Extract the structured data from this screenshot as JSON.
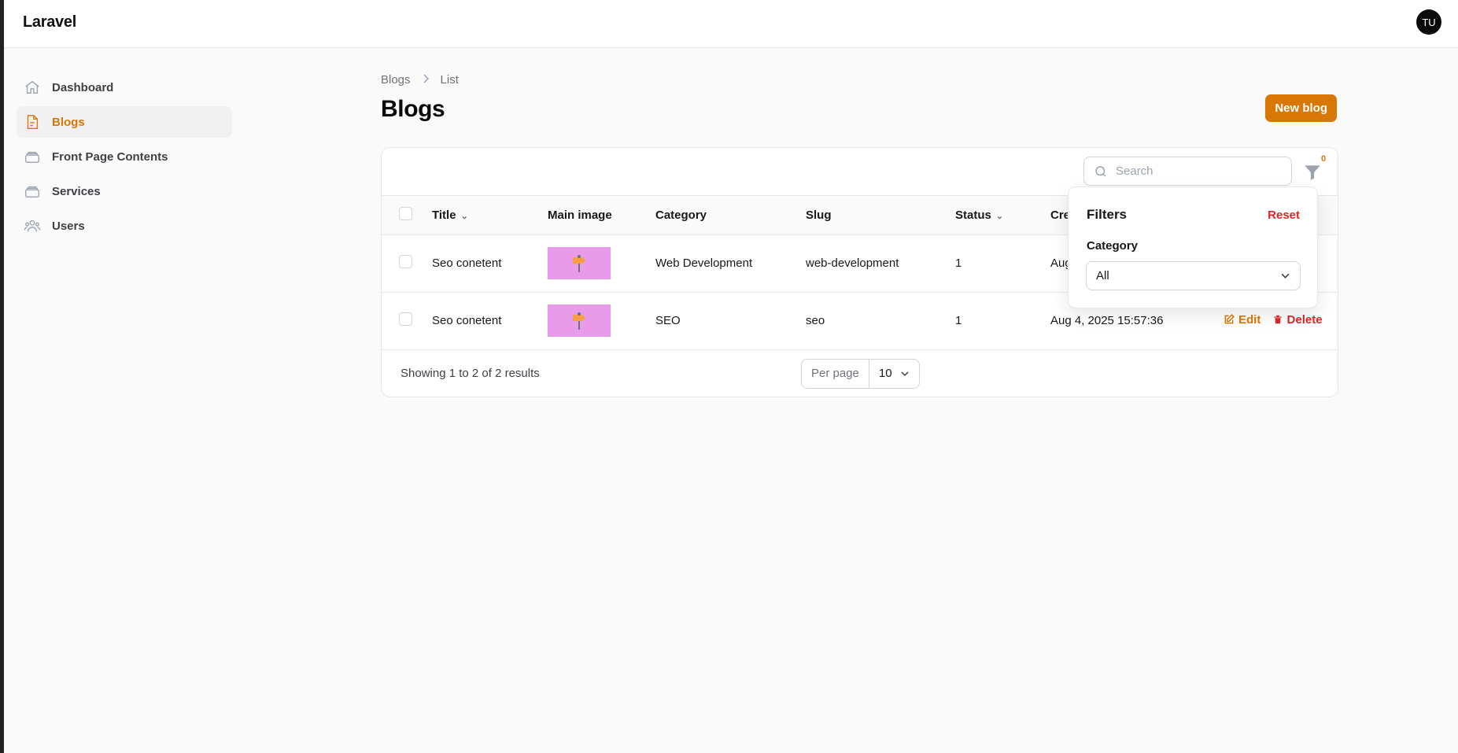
{
  "app": {
    "brand": "Laravel",
    "avatar_initials": "TU"
  },
  "sidebar": {
    "items": [
      {
        "label": "Dashboard",
        "icon": "home-icon",
        "active": false
      },
      {
        "label": "Blogs",
        "icon": "document-icon",
        "active": true
      },
      {
        "label": "Front Page Contents",
        "icon": "stack-icon",
        "active": false
      },
      {
        "label": "Services",
        "icon": "stack-icon",
        "active": false
      },
      {
        "label": "Users",
        "icon": "users-icon",
        "active": false
      }
    ]
  },
  "breadcrumb": [
    "Blogs",
    "List"
  ],
  "page": {
    "title": "Blogs",
    "new_button": "New blog"
  },
  "search": {
    "placeholder": "Search",
    "value": ""
  },
  "filters": {
    "count": "0",
    "title": "Filters",
    "reset": "Reset",
    "category_label": "Category",
    "category_value": "All"
  },
  "table": {
    "columns": [
      "Title",
      "Main image",
      "Category",
      "Slug",
      "Status",
      "Cre"
    ],
    "rows": [
      {
        "title": "Seo conetent",
        "category": "Web Development",
        "slug": "web-development",
        "status": "1",
        "created": "Aug"
      },
      {
        "title": "Seo conetent",
        "category": "SEO",
        "slug": "seo",
        "status": "1",
        "created": "Aug 4, 2025 15:57:36"
      }
    ],
    "actions": {
      "edit": "Edit",
      "delete": "Delete"
    }
  },
  "footer": {
    "showing": "Showing 1 to 2 of 2 results",
    "per_page_label": "Per page",
    "per_page_value": "10"
  },
  "colors": {
    "accent": "#d97706",
    "danger": "#dc2626",
    "thumb_bg": "#e89be8"
  }
}
